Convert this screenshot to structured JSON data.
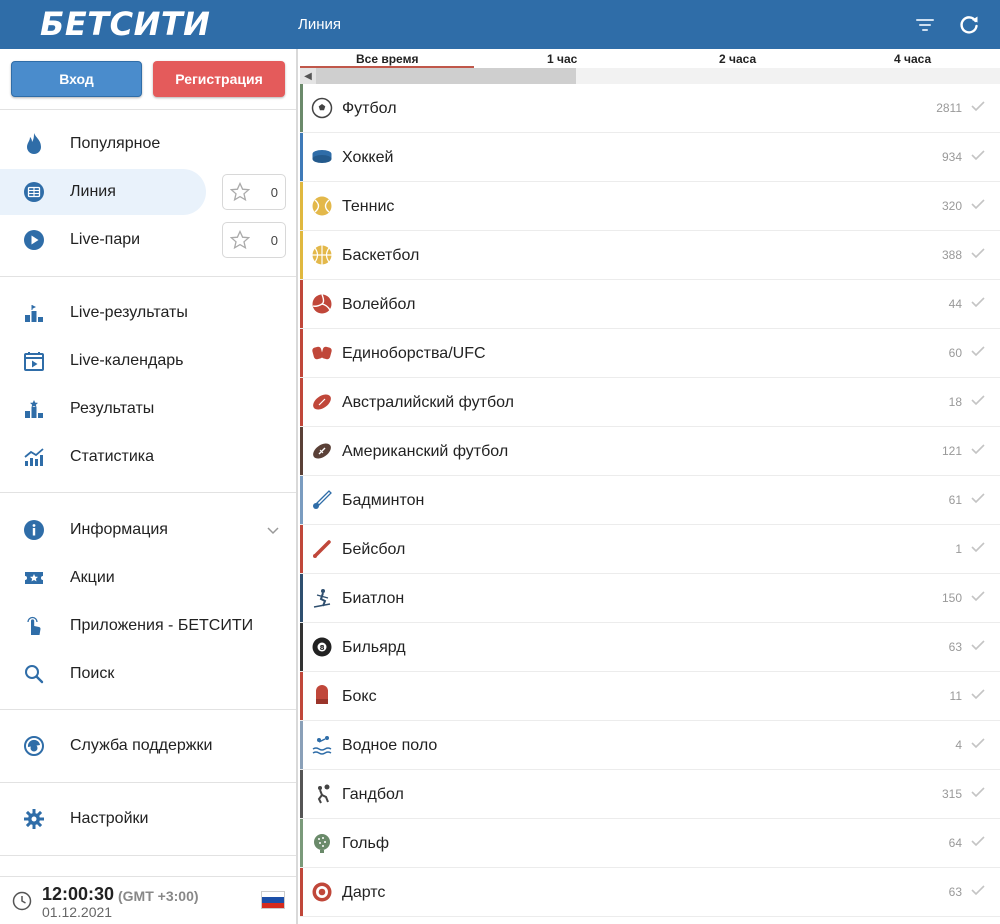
{
  "header": {
    "logo": "БЕТСИТИ",
    "title": "Линия"
  },
  "auth": {
    "login_label": "Вход",
    "register_label": "Регистрация"
  },
  "nav": {
    "main": [
      {
        "label": "Популярное",
        "icon": "flame-icon"
      },
      {
        "label": "Линия",
        "icon": "line-icon",
        "fav_count": "0",
        "active": true
      },
      {
        "label": "Live-пари",
        "icon": "play-icon",
        "fav_count": "0"
      }
    ],
    "results": [
      {
        "label": "Live-результаты",
        "icon": "podium-icon"
      },
      {
        "label": "Live-календарь",
        "icon": "calendar-icon"
      },
      {
        "label": "Результаты",
        "icon": "podium-icon"
      },
      {
        "label": "Статистика",
        "icon": "stats-icon"
      }
    ],
    "info": [
      {
        "label": "Информация",
        "icon": "info-icon"
      },
      {
        "label": "Акции",
        "icon": "ticket-icon"
      },
      {
        "label": "Приложения - БЕТСИТИ",
        "icon": "tap-icon"
      },
      {
        "label": "Поиск",
        "icon": "search-icon"
      }
    ],
    "support": {
      "label": "Служба поддержки",
      "icon": "support-icon"
    },
    "settings": {
      "label": "Настройки",
      "icon": "gear-icon"
    }
  },
  "clock": {
    "time": "12:00:30",
    "tz": "(GMT +3:00)",
    "date": "01.12.2021"
  },
  "tabs": [
    "Все время",
    "1 час",
    "2 часа",
    "4 часа"
  ],
  "colors": {
    "brand": "#2f6da8",
    "accent_red": "#e45b5b",
    "active_bg": "#e9f2fb"
  },
  "sports": [
    {
      "name": "Футбол",
      "count": "2811",
      "icon": "football-icon",
      "stripe": "#6b8a6b"
    },
    {
      "name": "Хоккей",
      "count": "934",
      "icon": "hockey-icon",
      "stripe": "#3f7ab8"
    },
    {
      "name": "Теннис",
      "count": "320",
      "icon": "tennis-icon",
      "stripe": "#e0b83f"
    },
    {
      "name": "Баскетбол",
      "count": "388",
      "icon": "basketball-icon",
      "stripe": "#e0b83f"
    },
    {
      "name": "Волейбол",
      "count": "44",
      "icon": "volleyball-icon",
      "stripe": "#c0473a"
    },
    {
      "name": "Единоборства/UFC",
      "count": "60",
      "icon": "gloves-icon",
      "stripe": "#c0473a"
    },
    {
      "name": "Австралийский футбол",
      "count": "18",
      "icon": "rugby-ball-icon",
      "stripe": "#c0473a"
    },
    {
      "name": "Американский футбол",
      "count": "121",
      "icon": "american-football-icon",
      "stripe": "#5a4037"
    },
    {
      "name": "Бадминтон",
      "count": "61",
      "icon": "shuttlecock-icon",
      "stripe": "#7a9cc0"
    },
    {
      "name": "Бейсбол",
      "count": "1",
      "icon": "baseball-bat-icon",
      "stripe": "#c0473a"
    },
    {
      "name": "Биатлон",
      "count": "150",
      "icon": "biathlon-icon",
      "stripe": "#2f4f6f"
    },
    {
      "name": "Бильярд",
      "count": "63",
      "icon": "billiard-ball-icon",
      "stripe": "#333333"
    },
    {
      "name": "Бокс",
      "count": "11",
      "icon": "boxing-glove-icon",
      "stripe": "#c0473a"
    },
    {
      "name": "Водное поло",
      "count": "4",
      "icon": "water-polo-icon",
      "stripe": "#8aa0b8"
    },
    {
      "name": "Гандбол",
      "count": "315",
      "icon": "handball-icon",
      "stripe": "#555555"
    },
    {
      "name": "Гольф",
      "count": "64",
      "icon": "golf-ball-icon",
      "stripe": "#7a9a7a"
    },
    {
      "name": "Дартс",
      "count": "63",
      "icon": "darts-icon",
      "stripe": "#c0473a"
    }
  ]
}
